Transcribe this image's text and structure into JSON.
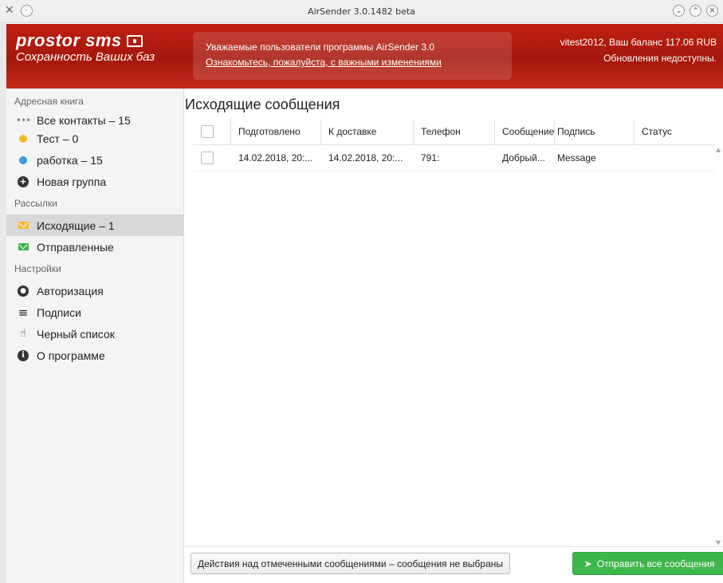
{
  "window": {
    "title": "AirSender 3.0.1482 beta",
    "left_icons": [
      "tools-icon",
      "minimize-circle-icon"
    ],
    "right_icons": [
      "collapse-icon",
      "expand-icon",
      "close-icon"
    ]
  },
  "header": {
    "logo_line1": "prostor sms",
    "logo_line2": "Сохранность Ваших баз",
    "notice_line1": "Уважаемые пользователи программы AirSender 3.0",
    "notice_link": "Ознакомьтесь, пожалуйста, с важными изменениями",
    "account_line1": "vitest2012, Ваш баланс 117.06 RUB",
    "account_line2": "Обновления недоступны."
  },
  "sidebar": {
    "address_book_title": "Адресная книга",
    "address_items": [
      {
        "label": "Все контакты – 15",
        "icon": "dots-icon"
      },
      {
        "label": "Тест – 0",
        "icon": "dot-icon",
        "color": "#f5b82e"
      },
      {
        "label": "работка – 15",
        "icon": "dot-icon",
        "color": "#3a97e6"
      },
      {
        "label": "Новая группа",
        "icon": "plus-circle-icon"
      }
    ],
    "mailings_title": "Рассылки",
    "mailing_items": [
      {
        "label": "Исходящие – 1",
        "icon": "envelope-icon",
        "color": "#f5b82e",
        "selected": true
      },
      {
        "label": "Отправленные",
        "icon": "envelope-icon",
        "color": "#3db54a"
      }
    ],
    "settings_title": "Настройки",
    "settings_items": [
      {
        "label": "Авторизация",
        "icon": "user-circle-icon"
      },
      {
        "label": "Подписи",
        "icon": "list-icon"
      },
      {
        "label": "Черный список",
        "icon": "hand-icon"
      },
      {
        "label": "О программе",
        "icon": "info-icon"
      }
    ]
  },
  "main": {
    "title": "Исходящие сообщения",
    "columns": [
      "Подготовлено",
      "К доставке",
      "Телефон",
      "Сообщение",
      "Подпись",
      "Статус"
    ],
    "rows": [
      {
        "prepared": "14.02.2018, 20:...",
        "delivery": "14.02.2018, 20:...",
        "phone": "791:",
        "message": "Добрый...",
        "signature": "Message",
        "status": ""
      }
    ],
    "actions_button": "Действия над отмеченными сообщениями – сообщения не выбраны",
    "send_button": "Отправить все сообщения"
  }
}
